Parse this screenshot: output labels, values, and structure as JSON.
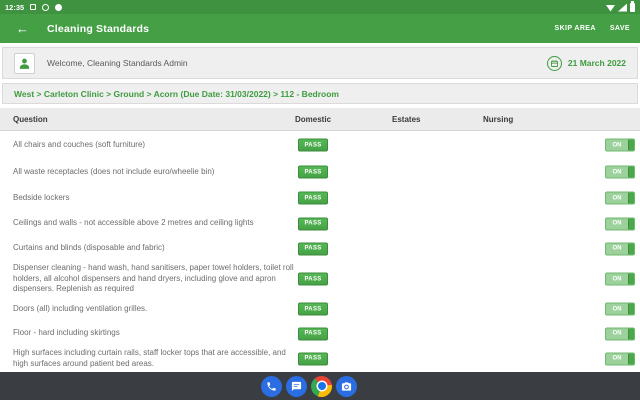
{
  "status_bar": {
    "time": "12:35"
  },
  "app_bar": {
    "title": "Cleaning Standards",
    "skip_area_label": "SKIP AREA",
    "save_label": "SAVE"
  },
  "welcome_bar": {
    "greeting": "Welcome, Cleaning Standards Admin",
    "date": "21 March 2022"
  },
  "breadcrumb": "West > Carleton Clinic > Ground > Acorn (Due Date: 31/03/2022) > 112 - Bedroom",
  "table": {
    "headers": {
      "question": "Question",
      "domestic": "Domestic",
      "estates": "Estates",
      "nursing": "Nursing"
    },
    "rows": [
      {
        "question": "All chairs and couches (soft furniture)",
        "domestic_status": "PASS",
        "toggle": "ON"
      },
      {
        "question": "All waste receptacles (does not include euro/wheelie bin)",
        "domestic_status": "PASS",
        "toggle": "ON"
      },
      {
        "question": "Bedside lockers",
        "domestic_status": "PASS",
        "toggle": "ON"
      },
      {
        "question": "Ceilings and walls - not accessible above 2 metres and ceiling lights",
        "domestic_status": "PASS",
        "toggle": "ON"
      },
      {
        "question": "Curtains and blinds (disposable and fabric)",
        "domestic_status": "PASS",
        "toggle": "ON"
      },
      {
        "question": "Dispenser cleaning - hand wash, hand sanitisers, paper towel holders, toilet roll holders, all alcohol dispensers and hand dryers, including glove and apron dispensers. Replenish as required",
        "domestic_status": "PASS",
        "toggle": "ON"
      },
      {
        "question": "Doors (all) including ventilation grilles.",
        "domestic_status": "PASS",
        "toggle": "ON"
      },
      {
        "question": "Floor - hard including skirtings",
        "domestic_status": "PASS",
        "toggle": "ON"
      },
      {
        "question": "High surfaces including curtain rails, staff locker tops that are accessible, and high surfaces around patient bed areas.",
        "domestic_status": "PASS",
        "toggle": "ON"
      }
    ]
  },
  "dock": {
    "icons": [
      "phone-icon",
      "messages-icon",
      "chrome-icon",
      "camera-icon"
    ]
  },
  "colors": {
    "status_bar_green": "#3E9240",
    "app_bar_green": "#45A045",
    "accent_green_text": "#3E9C40",
    "pass_button_green": "#4AA94A",
    "toggle_light_green": "#9CD19C",
    "dock_gray": "#3A3D41",
    "dock_icon_blue": "#2B6DE3"
  }
}
